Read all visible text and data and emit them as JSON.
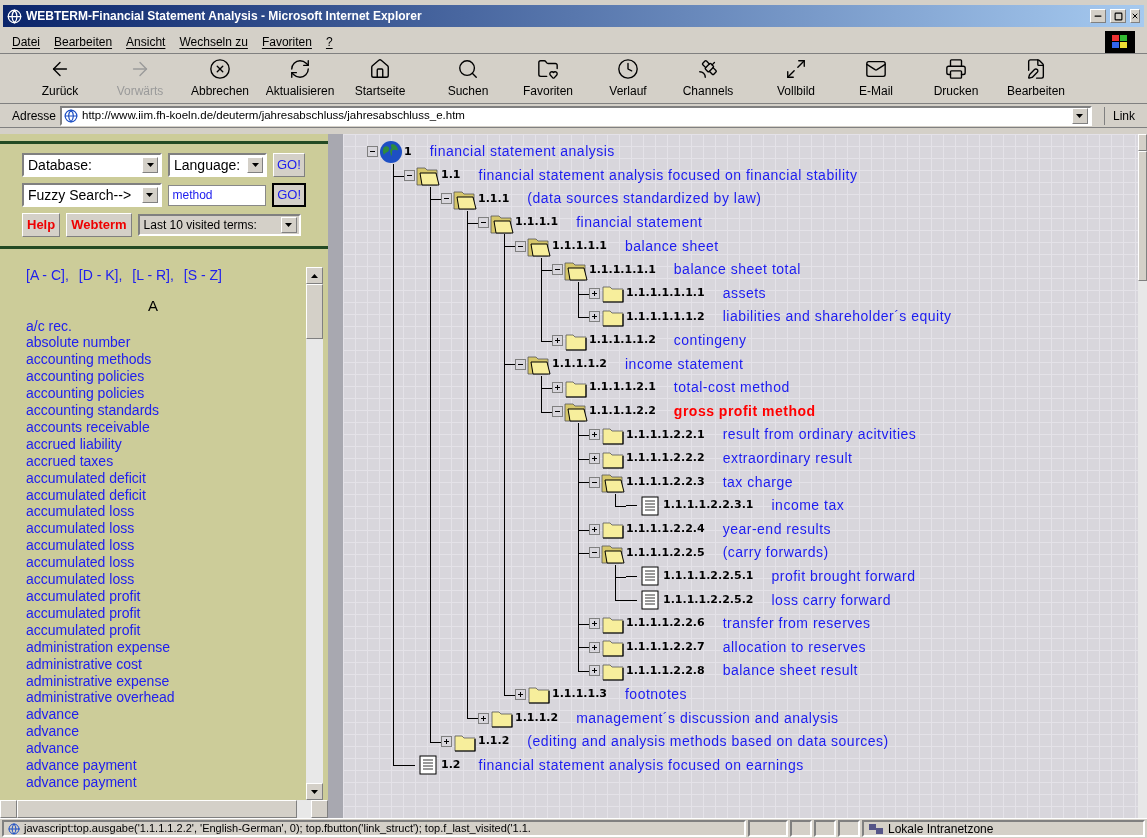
{
  "window": {
    "title": "WEBTERM-Financial Statement Analysis - Microsoft Internet Explorer"
  },
  "menu": [
    "Datei",
    "Bearbeiten",
    "Ansicht",
    "Wechseln zu",
    "Favoriten",
    "?"
  ],
  "toolbar": [
    {
      "kind": "back",
      "label": "Zurück",
      "disabled": false
    },
    {
      "kind": "forward",
      "label": "Vorwärts",
      "disabled": true
    },
    {
      "kind": "stop",
      "label": "Abbrechen",
      "disabled": false
    },
    {
      "kind": "refresh",
      "label": "Aktualisieren",
      "disabled": false
    },
    {
      "kind": "home",
      "label": "Startseite",
      "disabled": false
    },
    {
      "kind": "search",
      "label": "Suchen",
      "disabled": false
    },
    {
      "kind": "favorites",
      "label": "Favoriten",
      "disabled": false
    },
    {
      "kind": "history",
      "label": "Verlauf",
      "disabled": false
    },
    {
      "kind": "channels",
      "label": "Channels",
      "disabled": false
    },
    {
      "kind": "fullscreen",
      "label": "Vollbild",
      "disabled": false
    },
    {
      "kind": "mail",
      "label": "E-Mail",
      "disabled": false
    },
    {
      "kind": "print",
      "label": "Drucken",
      "disabled": false
    },
    {
      "kind": "edit",
      "label": "Bearbeiten",
      "disabled": false
    }
  ],
  "address": {
    "label": "Adresse",
    "url": "http://www.iim.fh-koeln.de/deuterm/jahresabschluss/jahresabschluss_e.htm",
    "links": "Link"
  },
  "search_panel": {
    "database": "Database:",
    "language": "Language:",
    "go": "GO!",
    "fuzzy": "Fuzzy Search-->",
    "query": "method",
    "go2": "GO!",
    "help": "Help",
    "webterm": "Webterm",
    "last_visited": "Last 10 visited terms:"
  },
  "ranges": [
    "[A - C],",
    "[D - K],",
    "[L - R],",
    "[S - Z]"
  ],
  "letter": "A",
  "terms": [
    "a/c rec.",
    "absolute number",
    "accounting methods",
    "accounting policies",
    "accounting policies",
    "accounting standards",
    "accounts receivable",
    "accrued liability",
    "accrued taxes",
    "accumulated deficit",
    "accumulated deficit",
    "accumulated loss",
    "accumulated loss",
    "accumulated loss",
    "accumulated loss",
    "accumulated loss",
    "accumulated profit",
    "accumulated profit",
    "accumulated profit",
    "administration expense",
    "administrative cost",
    "administrative expense",
    "administrative overhead",
    "advance",
    "advance",
    "advance",
    "advance payment",
    "advance payment"
  ],
  "tree": [
    {
      "kind": "globe",
      "number": "1",
      "label": "financial statement analysis",
      "expanded": true,
      "selected": false,
      "children": [
        {
          "kind": "folder",
          "number": "1.1",
          "label": "financial statement analysis focused on financial stability",
          "expanded": true,
          "selected": false,
          "children": [
            {
              "kind": "folder",
              "number": "1.1.1",
              "label": "(data sources standardized by law)",
              "expanded": true,
              "selected": false,
              "children": [
                {
                  "kind": "folder",
                  "number": "1.1.1.1",
                  "label": "financial statement",
                  "expanded": true,
                  "selected": false,
                  "children": [
                    {
                      "kind": "folder",
                      "number": "1.1.1.1.1",
                      "label": "balance sheet",
                      "expanded": true,
                      "selected": false,
                      "children": [
                        {
                          "kind": "folder",
                          "number": "1.1.1.1.1.1",
                          "label": "balance sheet total",
                          "expanded": true,
                          "selected": false,
                          "children": [
                            {
                              "kind": "folder",
                              "number": "1.1.1.1.1.1.1",
                              "label": "assets",
                              "expanded": false,
                              "selected": false
                            },
                            {
                              "kind": "folder",
                              "number": "1.1.1.1.1.1.2",
                              "label": "liabilities and shareholder´s equity",
                              "expanded": false,
                              "selected": false
                            }
                          ]
                        },
                        {
                          "kind": "folder",
                          "number": "1.1.1.1.1.2",
                          "label": "contingeny",
                          "expanded": false,
                          "selected": false
                        }
                      ]
                    },
                    {
                      "kind": "folder",
                      "number": "1.1.1.1.2",
                      "label": "income statement",
                      "expanded": true,
                      "selected": false,
                      "children": [
                        {
                          "kind": "folder",
                          "number": "1.1.1.1.2.1",
                          "label": "total-cost method",
                          "expanded": false,
                          "selected": false
                        },
                        {
                          "kind": "folder",
                          "number": "1.1.1.1.2.2",
                          "label": "gross profit method",
                          "expanded": true,
                          "selected": true,
                          "children": [
                            {
                              "kind": "folder",
                              "number": "1.1.1.1.2.2.1",
                              "label": "result from ordinary acitvities",
                              "expanded": false,
                              "selected": false
                            },
                            {
                              "kind": "folder",
                              "number": "1.1.1.1.2.2.2",
                              "label": "extraordinary result",
                              "expanded": false,
                              "selected": false
                            },
                            {
                              "kind": "folder",
                              "number": "1.1.1.1.2.2.3",
                              "label": "tax charge",
                              "expanded": true,
                              "selected": false,
                              "children": [
                                {
                                  "kind": "document",
                                  "number": "1.1.1.1.2.2.3.1",
                                  "label": "income tax",
                                  "selected": false
                                }
                              ]
                            },
                            {
                              "kind": "folder",
                              "number": "1.1.1.1.2.2.4",
                              "label": "year-end results",
                              "expanded": false,
                              "selected": false
                            },
                            {
                              "kind": "folder",
                              "number": "1.1.1.1.2.2.5",
                              "label": "(carry forwards)",
                              "expanded": true,
                              "selected": false,
                              "children": [
                                {
                                  "kind": "document",
                                  "number": "1.1.1.1.2.2.5.1",
                                  "label": "profit brought forward",
                                  "selected": false
                                },
                                {
                                  "kind": "document",
                                  "number": "1.1.1.1.2.2.5.2",
                                  "label": "loss carry forward",
                                  "selected": false
                                }
                              ]
                            },
                            {
                              "kind": "folder",
                              "number": "1.1.1.1.2.2.6",
                              "label": "transfer from reserves",
                              "expanded": false,
                              "selected": false
                            },
                            {
                              "kind": "folder",
                              "number": "1.1.1.1.2.2.7",
                              "label": "allocation to reserves",
                              "expanded": false,
                              "selected": false
                            },
                            {
                              "kind": "folder",
                              "number": "1.1.1.1.2.2.8",
                              "label": "balance sheet result",
                              "expanded": false,
                              "selected": false
                            }
                          ]
                        }
                      ]
                    },
                    {
                      "kind": "folder",
                      "number": "1.1.1.1.3",
                      "label": "footnotes",
                      "expanded": false,
                      "selected": false
                    }
                  ]
                },
                {
                  "kind": "folder",
                  "number": "1.1.1.2",
                  "label": "management´s discussion and analysis",
                  "expanded": false,
                  "selected": false
                }
              ]
            },
            {
              "kind": "folder",
              "number": "1.1.2",
              "label": "(editing and analysis methods based on data sources)",
              "expanded": false,
              "selected": false
            }
          ]
        },
        {
          "kind": "document",
          "number": "1.2",
          "label": "financial statement analysis focused on earnings",
          "selected": false
        }
      ]
    }
  ],
  "status_bar": {
    "text": "javascript:top.ausgabe('1.1.1.1.2.2', 'English-German', 0); top.fbutton('link_struct'); top.f_last_visited('1.1.",
    "zone": "Lokale Intranetzone"
  }
}
